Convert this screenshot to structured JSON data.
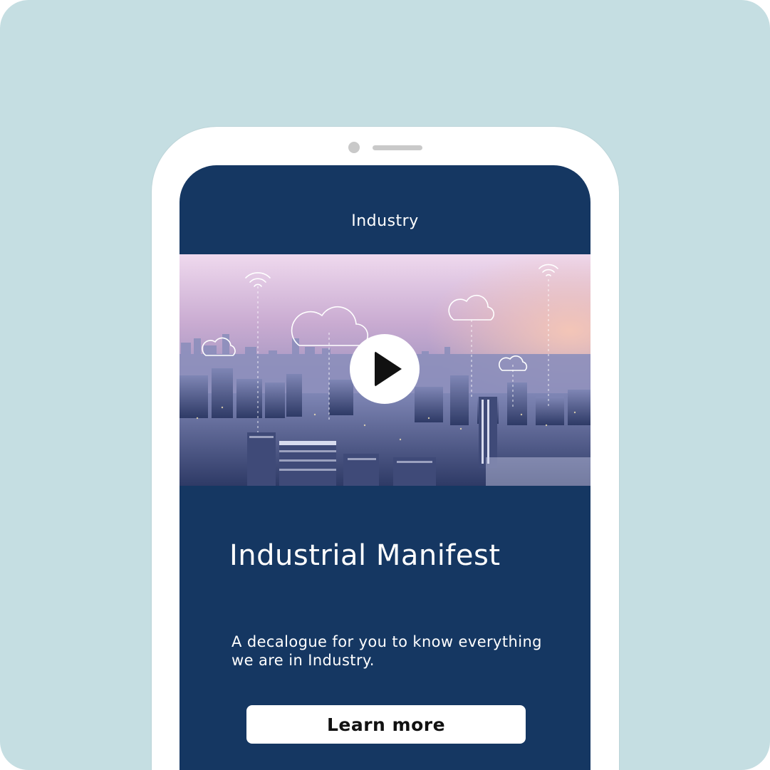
{
  "app_bar": {
    "title": "Industry"
  },
  "hero_video": {
    "play_icon": "play-icon",
    "image_description_icon_set": [
      "cloud-icon",
      "wifi-icon"
    ]
  },
  "content": {
    "headline": "Industrial Manifest",
    "subtitle": "A decalogue for you to know everything we are in Industry."
  },
  "cta": {
    "label": "Learn more"
  },
  "colors": {
    "background": "#c5dee2",
    "device": "#ffffff",
    "screen": "#153762",
    "text": "#ffffff",
    "button": "#ffffff",
    "button_text": "#111111"
  }
}
